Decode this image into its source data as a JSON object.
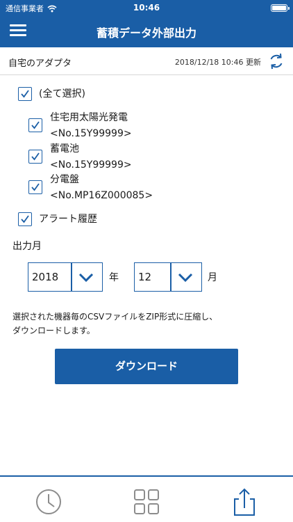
{
  "status_bar": {
    "carrier": "通信事業者",
    "time": "10:46"
  },
  "header": {
    "title": "蓄積データ外部出力"
  },
  "device": {
    "name": "自宅のアダプタ",
    "updated": "2018/12/18 10:46 更新"
  },
  "checkboxes": {
    "select_all": {
      "label": "(全て選択)",
      "checked": true
    },
    "items": [
      {
        "name": "住宅用太陽光発電",
        "serial": "<No.15Y99999>",
        "checked": true
      },
      {
        "name": "蓄電池",
        "serial": "<No.15Y99999>",
        "checked": true
      },
      {
        "name": "分電盤",
        "serial": "<No.MP16Z000085>",
        "checked": true
      }
    ],
    "alert_history": {
      "label": "アラート履歴",
      "checked": true
    }
  },
  "output_month": {
    "label": "出力月",
    "year": {
      "value": "2018",
      "unit": "年"
    },
    "month": {
      "value": "12",
      "unit": "月"
    }
  },
  "note": {
    "line1": "選択された機器毎のCSVファイルをZIP形式に圧縮し、",
    "line2": "ダウンロードします。"
  },
  "download_label": "ダウンロード",
  "tabbar": {
    "tabs": [
      "clock-icon",
      "grid-icon",
      "share-icon"
    ],
    "active": "share-icon"
  },
  "colors": {
    "primary": "#1a5ea6",
    "tab_inactive": "#8c8c8c"
  }
}
